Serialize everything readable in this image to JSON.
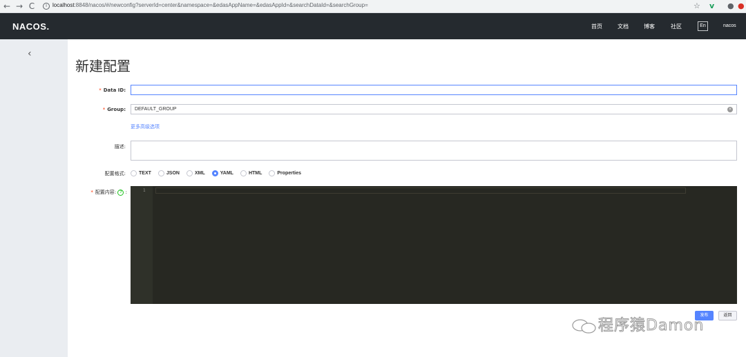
{
  "browser": {
    "back_icon": "arrow-left-icon",
    "forward_icon": "arrow-right-icon",
    "reload_icon": "reload-icon",
    "url_host": "localhost",
    "url_rest": ":8848/nacos/#/newconfig?serverId=center&namespace=&edasAppName=&edasAppId=&searchDataId=&searchGroup="
  },
  "header": {
    "logo": "NACOS.",
    "nav": [
      "首页",
      "文档",
      "博客",
      "社区"
    ],
    "lang": "En",
    "user": "nacos"
  },
  "page": {
    "title": "新建配置"
  },
  "form": {
    "data_id_label": "Data ID:",
    "data_id_value": "",
    "group_label": "Group:",
    "group_value": "DEFAULT_GROUP",
    "more_options": "更多高级选项",
    "desc_label": "描述:",
    "format_label": "配置格式:",
    "formats": [
      "TEXT",
      "JSON",
      "XML",
      "YAML",
      "HTML",
      "Properties"
    ],
    "selected_format": "YAML",
    "content_label": "配置内容:",
    "content_help": "?",
    "line_number": "1"
  },
  "actions": {
    "publish": "发布",
    "back": "返回"
  },
  "watermark": {
    "text": "程序猿Damon"
  },
  "colors": {
    "accent": "#5584ff",
    "header_bg": "#252a2f",
    "required": "#ff3000",
    "editor_bg": "#272822"
  }
}
